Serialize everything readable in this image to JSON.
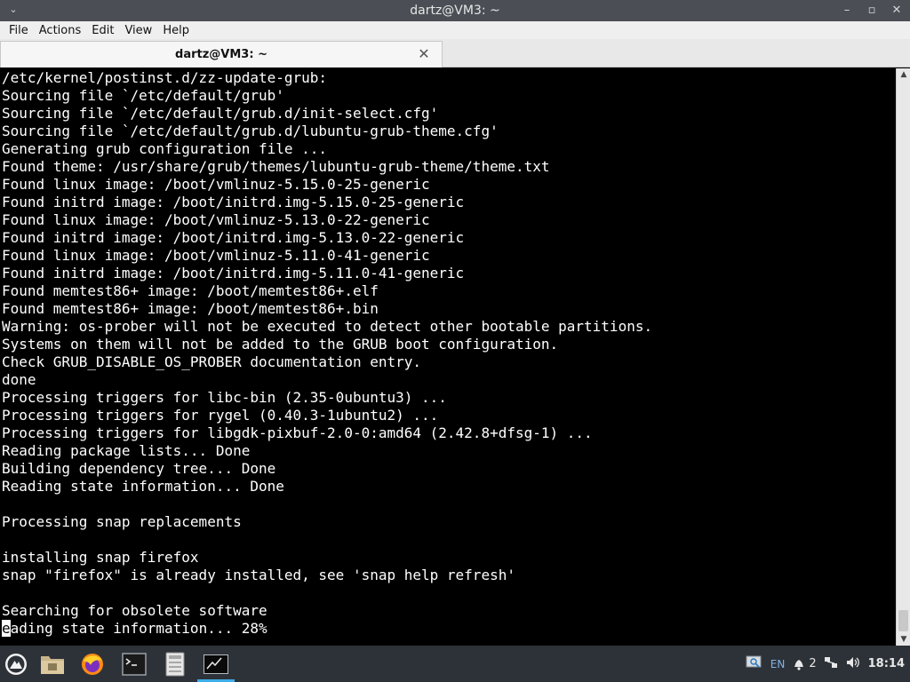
{
  "window": {
    "title": "dartz@VM3: ~",
    "menu_glyph": "⌄",
    "controls": {
      "minimize": "–",
      "maximize": "▫",
      "close": "✕"
    }
  },
  "menubar": {
    "items": [
      "File",
      "Actions",
      "Edit",
      "View",
      "Help"
    ]
  },
  "tabs": [
    {
      "label": "dartz@VM3: ~",
      "close_glyph": "✕"
    }
  ],
  "terminal": {
    "lines": [
      "/etc/kernel/postinst.d/zz-update-grub:",
      "Sourcing file `/etc/default/grub'",
      "Sourcing file `/etc/default/grub.d/init-select.cfg'",
      "Sourcing file `/etc/default/grub.d/lubuntu-grub-theme.cfg'",
      "Generating grub configuration file ...",
      "Found theme: /usr/share/grub/themes/lubuntu-grub-theme/theme.txt",
      "Found linux image: /boot/vmlinuz-5.15.0-25-generic",
      "Found initrd image: /boot/initrd.img-5.15.0-25-generic",
      "Found linux image: /boot/vmlinuz-5.13.0-22-generic",
      "Found initrd image: /boot/initrd.img-5.13.0-22-generic",
      "Found linux image: /boot/vmlinuz-5.11.0-41-generic",
      "Found initrd image: /boot/initrd.img-5.11.0-41-generic",
      "Found memtest86+ image: /boot/memtest86+.elf",
      "Found memtest86+ image: /boot/memtest86+.bin",
      "Warning: os-prober will not be executed to detect other bootable partitions.",
      "Systems on them will not be added to the GRUB boot configuration.",
      "Check GRUB_DISABLE_OS_PROBER documentation entry.",
      "done",
      "Processing triggers for libc-bin (2.35-0ubuntu3) ...",
      "Processing triggers for rygel (0.40.3-1ubuntu2) ...",
      "Processing triggers for libgdk-pixbuf-2.0-0:amd64 (2.42.8+dfsg-1) ...",
      "Reading package lists... Done",
      "Building dependency tree... Done",
      "Reading state information... Done",
      "",
      "Processing snap replacements",
      "",
      "installing snap firefox",
      "snap \"firefox\" is already installed, see 'snap help refresh'",
      "",
      "Searching for obsolete software"
    ],
    "last_line": {
      "cursor_char": "e",
      "rest": "ading state information... 28%"
    }
  },
  "taskbar": {
    "apps": [
      {
        "name": "lubuntu-menu-icon"
      },
      {
        "name": "file-manager-icon"
      },
      {
        "name": "firefox-icon"
      },
      {
        "name": "terminal-icon"
      },
      {
        "name": "text-editor-icon"
      },
      {
        "name": "active-terminal-window-icon"
      }
    ],
    "tray": {
      "language": "EN",
      "notifications_count": "2",
      "clock": "18:14"
    }
  },
  "colors": {
    "accent": "#3daee9",
    "panel": "#2d3238",
    "titlebar": "#4b4f55"
  }
}
